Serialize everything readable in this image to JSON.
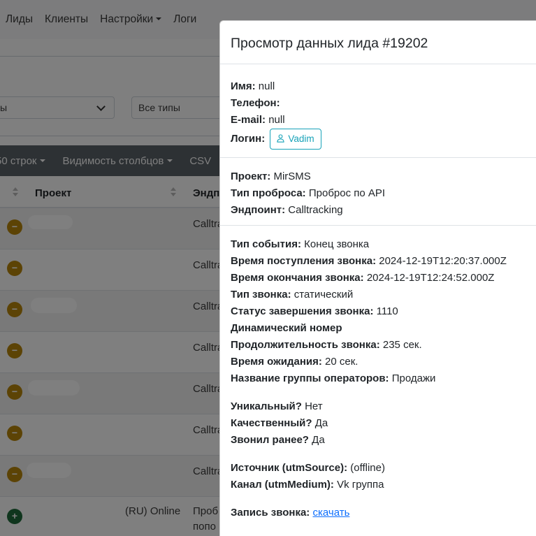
{
  "navbar": {
    "items": [
      "Лиды",
      "Клиенты",
      "Настройки",
      "Логи"
    ]
  },
  "filters": {
    "first_select_value": "ы",
    "second_select_value": "Все типы"
  },
  "toolbar": {
    "rows_label": "50 строк",
    "columns_label": "Видимость столбцов",
    "csv_label": "CSV"
  },
  "table": {
    "headers": {
      "project": "Проект",
      "endpoint": "Эндп"
    },
    "rows": [
      {
        "icon": "−",
        "project_suffix": "",
        "endpoint": "Calltra"
      },
      {
        "icon": "−",
        "project_suffix": "",
        "endpoint": "Calltra"
      },
      {
        "icon": "−",
        "project_suffix": "",
        "endpoint": "Calltra"
      },
      {
        "icon": "−",
        "project_suffix": "",
        "endpoint": "Calltra"
      },
      {
        "icon": "−",
        "project_suffix": "",
        "endpoint": "Calltra"
      },
      {
        "icon": "−",
        "project_suffix": "",
        "endpoint": "Calltra"
      },
      {
        "icon": "−",
        "project_suffix": "",
        "endpoint": "Calltra"
      },
      {
        "icon": "+",
        "project_suffix": "(RU) Online",
        "endpoint": "Проб",
        "endpoint_line2": "попо"
      }
    ]
  },
  "modal": {
    "title": "Просмотр данных лида #19202",
    "contact": {
      "name_label": "Имя:",
      "name_value": "null",
      "phone_label": "Телефон:",
      "phone_value": "",
      "email_label": "E-mail:",
      "email_value": "null",
      "login_label": "Логин:",
      "login_value": "Vadim"
    },
    "project": {
      "project_label": "Проект:",
      "project_value": "MirSMS",
      "type_label": "Тип проброса:",
      "type_value": "Проброс по API",
      "endpoint_label": "Эндпоинт:",
      "endpoint_value": "Calltracking"
    },
    "call": {
      "event_label": "Тип события:",
      "event_value": "Конец звонка",
      "start_label": "Время поступления звонка:",
      "start_value": "2024-12-19T12:20:37.000Z",
      "end_label": "Время окончания звонка:",
      "end_value": "2024-12-19T12:24:52.000Z",
      "calltype_label": "Тип звонка:",
      "calltype_value": "статический",
      "status_label": "Статус завершения звонка:",
      "status_value": "1110",
      "dynamic_label": "Динамический номер",
      "duration_label": "Продолжительность звонка:",
      "duration_value": "235 сек.",
      "wait_label": "Время ожидания:",
      "wait_value": "20 сек.",
      "group_label": "Название группы операторов:",
      "group_value": "Продажи"
    },
    "quality": {
      "unique_label": "Уникальный?",
      "unique_value": "Нет",
      "quality_label": "Качественный?",
      "quality_value": "Да",
      "called_label": "Звонил ранее?",
      "called_value": "Да"
    },
    "utm": {
      "source_label": "Источник (utmSource):",
      "source_value": "(offline)",
      "medium_label": "Канал (utmMedium):",
      "medium_value": "Vk группа"
    },
    "recording": {
      "label": "Запись звонка:",
      "link": "скачать"
    }
  },
  "colors": {
    "accent_info": "#17a2b8",
    "link": "#0d6efd",
    "toolbar_bg": "#5a6268",
    "badge_minus": "#b8860b",
    "badge_plus": "#1e6b3a"
  }
}
